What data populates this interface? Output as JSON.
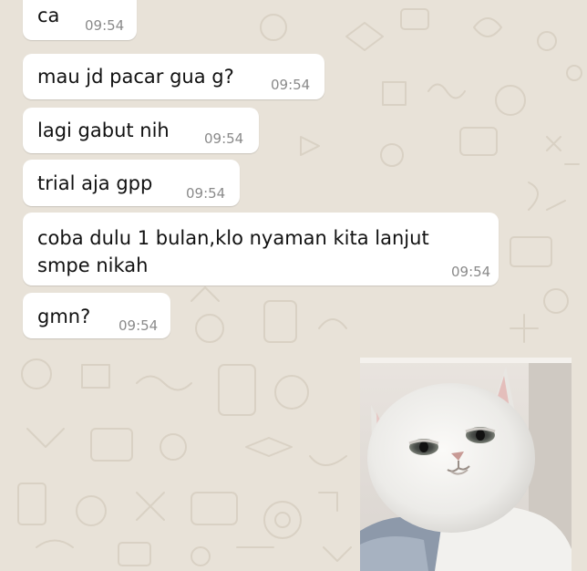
{
  "messages": [
    {
      "text": "ca",
      "time": "09:54"
    },
    {
      "text": "mau jd pacar gua g?",
      "time": "09:54"
    },
    {
      "text": "lagi gabut nih",
      "time": "09:54"
    },
    {
      "text": "trial aja gpp",
      "time": "09:54"
    },
    {
      "text": "coba dulu 1 bulan,klo nyaman kita lanjut smpe nikah",
      "time": "09:54"
    },
    {
      "text": "gmn?",
      "time": "09:54"
    }
  ],
  "sticker": {
    "icon": "cat-sticker-icon"
  },
  "colors": {
    "chat_background": "#e8e2d8",
    "bubble": "#ffffff",
    "timestamp": "#8a8a8a",
    "text": "#111111"
  }
}
